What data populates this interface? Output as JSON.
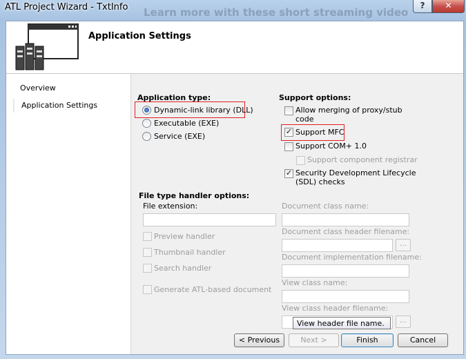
{
  "window": {
    "title": "ATL Project Wizard - TxtInfo",
    "background_text": "Learn more with these short streaming video",
    "help_label": "?",
    "close_label": "✕"
  },
  "header": {
    "title": "Application Settings",
    "icon": "wizard-icon"
  },
  "nav": {
    "items": [
      {
        "label": "Overview"
      },
      {
        "label": "Application Settings"
      }
    ]
  },
  "app_type": {
    "heading": "Application type:",
    "options": [
      {
        "label": "Dynamic-link library (DLL)",
        "selected": true
      },
      {
        "label": "Executable (EXE)",
        "selected": false
      },
      {
        "label": "Service (EXE)",
        "selected": false
      }
    ]
  },
  "support": {
    "heading": "Support options:",
    "options": [
      {
        "label": "Allow merging of proxy/stub",
        "label2": "code",
        "checked": false,
        "enabled": true
      },
      {
        "label": "Support MFC",
        "checked": true,
        "enabled": true
      },
      {
        "label": "Support COM+ 1.0",
        "checked": false,
        "enabled": true
      },
      {
        "label": "Support component registrar",
        "checked": false,
        "enabled": false
      },
      {
        "label": "Security Development Lifecycle",
        "label2": "(SDL) checks",
        "checked": true,
        "enabled": true
      }
    ]
  },
  "file_type": {
    "heading": "File type handler options:",
    "extension_label": "File extension:",
    "extension_value": "",
    "handlers": [
      {
        "label": "Preview handler"
      },
      {
        "label": "Thumbnail handler"
      },
      {
        "label": "Search handler"
      },
      {
        "label": "Generate ATL-based document"
      }
    ],
    "fields": [
      {
        "label": "Document class name:",
        "value": ""
      },
      {
        "label": "Document class header filename:",
        "value": ""
      },
      {
        "label": "Document implementation filename:",
        "value": ""
      },
      {
        "label": "View class name:",
        "value": ""
      },
      {
        "label": "View class header filename:",
        "value": ""
      }
    ],
    "browse_label": "..."
  },
  "tooltip": "View header file name.",
  "buttons": {
    "previous": "< Previous",
    "next": "Next >",
    "finish": "Finish",
    "cancel": "Cancel"
  },
  "colors": {
    "highlight_box": "#e02020",
    "title_bar": "#b9d1ea"
  }
}
